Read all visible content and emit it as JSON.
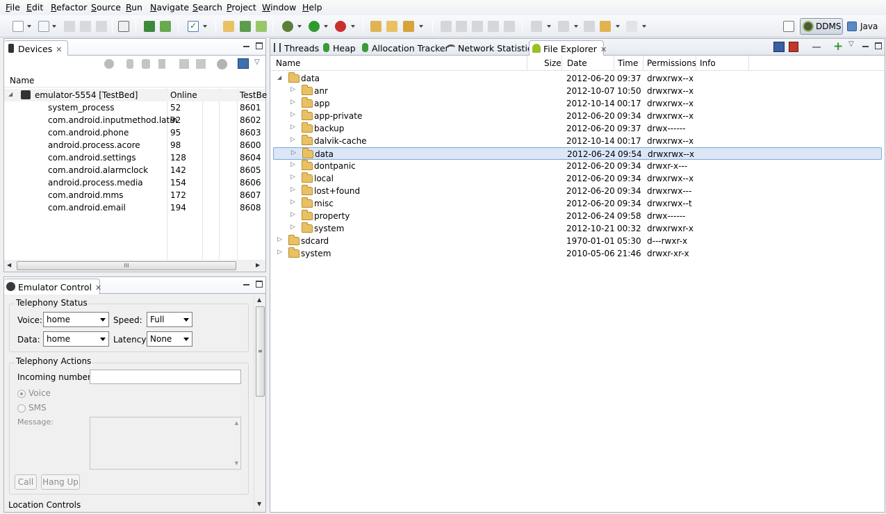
{
  "menu": [
    "File",
    "Edit",
    "Refactor",
    "Source",
    "Run",
    "Navigate",
    "Search",
    "Project",
    "Window",
    "Help"
  ],
  "perspectives": {
    "ddms": "DDMS",
    "java": "Java"
  },
  "devices_panel": {
    "tab_label": "Devices",
    "columns": [
      "Name",
      "Online",
      "TestBe"
    ],
    "device": {
      "name": "emulator-5554 [TestBed]",
      "status": "Online",
      "extra": ""
    },
    "processes": [
      {
        "name": "system_process",
        "pid": "52",
        "port": "8601"
      },
      {
        "name": "com.android.inputmethod.latin",
        "pid": "92",
        "port": "8602"
      },
      {
        "name": "com.android.phone",
        "pid": "95",
        "port": "8603"
      },
      {
        "name": "android.process.acore",
        "pid": "98",
        "port": "8600"
      },
      {
        "name": "com.android.settings",
        "pid": "128",
        "port": "8604"
      },
      {
        "name": "com.android.alarmclock",
        "pid": "142",
        "port": "8605"
      },
      {
        "name": "android.process.media",
        "pid": "154",
        "port": "8606"
      },
      {
        "name": "com.android.mms",
        "pid": "172",
        "port": "8607"
      },
      {
        "name": "com.android.email",
        "pid": "194",
        "port": "8608"
      }
    ],
    "hscroll_grip": "III"
  },
  "emulator_control": {
    "tab_label": "Emulator Control",
    "telephony_status": {
      "title": "Telephony Status",
      "voice_label": "Voice:",
      "voice_value": "home",
      "speed_label": "Speed:",
      "speed_value": "Full",
      "data_label": "Data:",
      "data_value": "home",
      "latency_label": "Latency:",
      "latency_value": "None"
    },
    "telephony_actions": {
      "title": "Telephony Actions",
      "incoming_label": "Incoming number:",
      "incoming_value": "",
      "voice_radio": "Voice",
      "sms_radio": "SMS",
      "message_label": "Message:",
      "call_button": "Call",
      "hangup_button": "Hang Up"
    },
    "location_controls": "Location Controls"
  },
  "right_tabs": [
    "Threads",
    "Heap",
    "Allocation Tracker",
    "Network Statistics",
    "File Explorer"
  ],
  "file_explorer": {
    "columns": [
      "Name",
      "Size",
      "Date",
      "Time",
      "Permissions",
      "Info"
    ],
    "rows": [
      {
        "name": "data",
        "level": 0,
        "expanded": true,
        "size": "",
        "date": "2012-06-20",
        "time": "09:37",
        "perm": "drwxrwx--x",
        "selected": false
      },
      {
        "name": "anr",
        "level": 1,
        "expanded": false,
        "size": "",
        "date": "2012-10-07",
        "time": "10:50",
        "perm": "drwxrwx--x",
        "selected": false
      },
      {
        "name": "app",
        "level": 1,
        "expanded": false,
        "size": "",
        "date": "2012-10-14",
        "time": "00:17",
        "perm": "drwxrwx--x",
        "selected": false
      },
      {
        "name": "app-private",
        "level": 1,
        "expanded": false,
        "size": "",
        "date": "2012-06-20",
        "time": "09:34",
        "perm": "drwxrwx--x",
        "selected": false
      },
      {
        "name": "backup",
        "level": 1,
        "expanded": false,
        "size": "",
        "date": "2012-06-20",
        "time": "09:37",
        "perm": "drwx------",
        "selected": false
      },
      {
        "name": "dalvik-cache",
        "level": 1,
        "expanded": false,
        "size": "",
        "date": "2012-10-14",
        "time": "00:17",
        "perm": "drwxrwx--x",
        "selected": false
      },
      {
        "name": "data",
        "level": 1,
        "expanded": false,
        "size": "",
        "date": "2012-06-24",
        "time": "09:54",
        "perm": "drwxrwx--x",
        "selected": true
      },
      {
        "name": "dontpanic",
        "level": 1,
        "expanded": false,
        "size": "",
        "date": "2012-06-20",
        "time": "09:34",
        "perm": "drwxr-x---",
        "selected": false
      },
      {
        "name": "local",
        "level": 1,
        "expanded": false,
        "size": "",
        "date": "2012-06-20",
        "time": "09:34",
        "perm": "drwxrwx--x",
        "selected": false
      },
      {
        "name": "lost+found",
        "level": 1,
        "expanded": false,
        "size": "",
        "date": "2012-06-20",
        "time": "09:34",
        "perm": "drwxrwx---",
        "selected": false
      },
      {
        "name": "misc",
        "level": 1,
        "expanded": false,
        "size": "",
        "date": "2012-06-20",
        "time": "09:34",
        "perm": "drwxrwx--t",
        "selected": false
      },
      {
        "name": "property",
        "level": 1,
        "expanded": false,
        "size": "",
        "date": "2012-06-24",
        "time": "09:58",
        "perm": "drwx------",
        "selected": false
      },
      {
        "name": "system",
        "level": 1,
        "expanded": false,
        "size": "",
        "date": "2012-10-21",
        "time": "00:32",
        "perm": "drwxrwxr-x",
        "selected": false
      },
      {
        "name": "sdcard",
        "level": 0,
        "expanded": false,
        "size": "",
        "date": "1970-01-01",
        "time": "05:30",
        "perm": "d---rwxr-x",
        "selected": false
      },
      {
        "name": "system",
        "level": 0,
        "expanded": false,
        "size": "",
        "date": "2010-05-06",
        "time": "21:46",
        "perm": "drwxr-xr-x",
        "selected": false
      }
    ]
  }
}
